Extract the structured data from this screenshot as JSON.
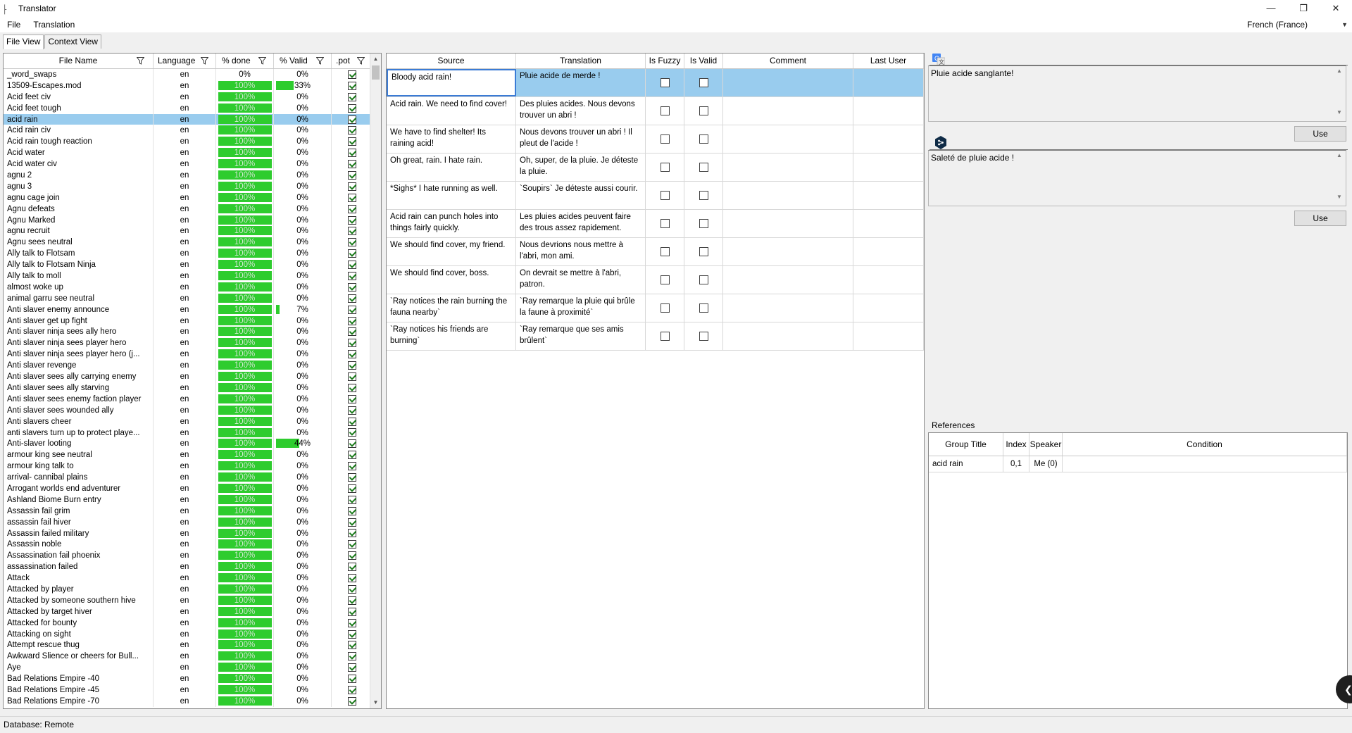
{
  "window": {
    "title": "Translator",
    "min": "—",
    "restore": "❐",
    "close": "✕"
  },
  "menu": {
    "file": "File",
    "translation": "Translation"
  },
  "language_select": {
    "value": "French (France)"
  },
  "tabs": [
    {
      "label": "File View"
    },
    {
      "label": "Context View"
    }
  ],
  "file_table": {
    "headers": {
      "name": "File Name",
      "lang": "Language",
      "done": "% done",
      "valid": "% Valid",
      "pot": ".pot"
    },
    "rows": [
      {
        "name": "_word_swaps",
        "lang": "en",
        "done": "0%",
        "done_pct": 0,
        "valid": "0%",
        "valid_pct": 0,
        "pot": true
      },
      {
        "name": "13509-Escapes.mod",
        "lang": "en",
        "done": "100%",
        "done_pct": 100,
        "valid": "33%",
        "valid_pct": 33,
        "pot": true
      },
      {
        "name": "Acid feet civ",
        "lang": "en",
        "done": "100%",
        "done_pct": 100,
        "valid": "0%",
        "valid_pct": 0,
        "pot": true
      },
      {
        "name": "Acid feet tough",
        "lang": "en",
        "done": "100%",
        "done_pct": 100,
        "valid": "0%",
        "valid_pct": 0,
        "pot": true
      },
      {
        "name": "acid rain",
        "lang": "en",
        "done": "100%",
        "done_pct": 100,
        "valid": "0%",
        "valid_pct": 0,
        "pot": true,
        "selected": true
      },
      {
        "name": "Acid rain civ",
        "lang": "en",
        "done": "100%",
        "done_pct": 100,
        "valid": "0%",
        "valid_pct": 0,
        "pot": true
      },
      {
        "name": "Acid rain tough reaction",
        "lang": "en",
        "done": "100%",
        "done_pct": 100,
        "valid": "0%",
        "valid_pct": 0,
        "pot": true
      },
      {
        "name": "Acid water",
        "lang": "en",
        "done": "100%",
        "done_pct": 100,
        "valid": "0%",
        "valid_pct": 0,
        "pot": true
      },
      {
        "name": "Acid water civ",
        "lang": "en",
        "done": "100%",
        "done_pct": 100,
        "valid": "0%",
        "valid_pct": 0,
        "pot": true
      },
      {
        "name": "agnu 2",
        "lang": "en",
        "done": "100%",
        "done_pct": 100,
        "valid": "0%",
        "valid_pct": 0,
        "pot": true
      },
      {
        "name": "agnu 3",
        "lang": "en",
        "done": "100%",
        "done_pct": 100,
        "valid": "0%",
        "valid_pct": 0,
        "pot": true
      },
      {
        "name": "agnu cage join",
        "lang": "en",
        "done": "100%",
        "done_pct": 100,
        "valid": "0%",
        "valid_pct": 0,
        "pot": true
      },
      {
        "name": "Agnu defeats",
        "lang": "en",
        "done": "100%",
        "done_pct": 100,
        "valid": "0%",
        "valid_pct": 0,
        "pot": true
      },
      {
        "name": "Agnu Marked",
        "lang": "en",
        "done": "100%",
        "done_pct": 100,
        "valid": "0%",
        "valid_pct": 0,
        "pot": true
      },
      {
        "name": "agnu recruit",
        "lang": "en",
        "done": "100%",
        "done_pct": 100,
        "valid": "0%",
        "valid_pct": 0,
        "pot": true
      },
      {
        "name": "Agnu sees neutral",
        "lang": "en",
        "done": "100%",
        "done_pct": 100,
        "valid": "0%",
        "valid_pct": 0,
        "pot": true
      },
      {
        "name": "Ally talk to Flotsam",
        "lang": "en",
        "done": "100%",
        "done_pct": 100,
        "valid": "0%",
        "valid_pct": 0,
        "pot": true
      },
      {
        "name": "Ally talk to Flotsam Ninja",
        "lang": "en",
        "done": "100%",
        "done_pct": 100,
        "valid": "0%",
        "valid_pct": 0,
        "pot": true
      },
      {
        "name": "Ally talk to moll",
        "lang": "en",
        "done": "100%",
        "done_pct": 100,
        "valid": "0%",
        "valid_pct": 0,
        "pot": true
      },
      {
        "name": "almost woke up",
        "lang": "en",
        "done": "100%",
        "done_pct": 100,
        "valid": "0%",
        "valid_pct": 0,
        "pot": true
      },
      {
        "name": "animal garru see neutral",
        "lang": "en",
        "done": "100%",
        "done_pct": 100,
        "valid": "0%",
        "valid_pct": 0,
        "pot": true
      },
      {
        "name": "Anti slaver enemy announce",
        "lang": "en",
        "done": "100%",
        "done_pct": 100,
        "valid": "7%",
        "valid_pct": 7,
        "pot": true
      },
      {
        "name": "Anti slaver get up fight",
        "lang": "en",
        "done": "100%",
        "done_pct": 100,
        "valid": "0%",
        "valid_pct": 0,
        "pot": true
      },
      {
        "name": "Anti slaver ninja sees ally hero",
        "lang": "en",
        "done": "100%",
        "done_pct": 100,
        "valid": "0%",
        "valid_pct": 0,
        "pot": true
      },
      {
        "name": "Anti slaver ninja sees player hero",
        "lang": "en",
        "done": "100%",
        "done_pct": 100,
        "valid": "0%",
        "valid_pct": 0,
        "pot": true
      },
      {
        "name": "Anti slaver ninja sees player hero (j...",
        "lang": "en",
        "done": "100%",
        "done_pct": 100,
        "valid": "0%",
        "valid_pct": 0,
        "pot": true
      },
      {
        "name": "Anti slaver revenge",
        "lang": "en",
        "done": "100%",
        "done_pct": 100,
        "valid": "0%",
        "valid_pct": 0,
        "pot": true
      },
      {
        "name": "Anti slaver sees ally carrying enemy",
        "lang": "en",
        "done": "100%",
        "done_pct": 100,
        "valid": "0%",
        "valid_pct": 0,
        "pot": true
      },
      {
        "name": "Anti slaver sees ally starving",
        "lang": "en",
        "done": "100%",
        "done_pct": 100,
        "valid": "0%",
        "valid_pct": 0,
        "pot": true
      },
      {
        "name": "Anti slaver sees enemy faction player",
        "lang": "en",
        "done": "100%",
        "done_pct": 100,
        "valid": "0%",
        "valid_pct": 0,
        "pot": true
      },
      {
        "name": "Anti slaver sees wounded ally",
        "lang": "en",
        "done": "100%",
        "done_pct": 100,
        "valid": "0%",
        "valid_pct": 0,
        "pot": true
      },
      {
        "name": "Anti slavers cheer",
        "lang": "en",
        "done": "100%",
        "done_pct": 100,
        "valid": "0%",
        "valid_pct": 0,
        "pot": true
      },
      {
        "name": "anti slavers turn up to protect playe...",
        "lang": "en",
        "done": "100%",
        "done_pct": 100,
        "valid": "0%",
        "valid_pct": 0,
        "pot": true
      },
      {
        "name": "Anti-slaver looting",
        "lang": "en",
        "done": "100%",
        "done_pct": 100,
        "valid": "44%",
        "valid_pct": 44,
        "pot": true
      },
      {
        "name": "armour king see neutral",
        "lang": "en",
        "done": "100%",
        "done_pct": 100,
        "valid": "0%",
        "valid_pct": 0,
        "pot": true
      },
      {
        "name": "armour king talk to",
        "lang": "en",
        "done": "100%",
        "done_pct": 100,
        "valid": "0%",
        "valid_pct": 0,
        "pot": true
      },
      {
        "name": "arrival- cannibal plains",
        "lang": "en",
        "done": "100%",
        "done_pct": 100,
        "valid": "0%",
        "valid_pct": 0,
        "pot": true
      },
      {
        "name": "Arrogant worlds end adventurer",
        "lang": "en",
        "done": "100%",
        "done_pct": 100,
        "valid": "0%",
        "valid_pct": 0,
        "pot": true
      },
      {
        "name": "Ashland Biome Burn entry",
        "lang": "en",
        "done": "100%",
        "done_pct": 100,
        "valid": "0%",
        "valid_pct": 0,
        "pot": true
      },
      {
        "name": "Assassin fail grim",
        "lang": "en",
        "done": "100%",
        "done_pct": 100,
        "valid": "0%",
        "valid_pct": 0,
        "pot": true
      },
      {
        "name": "assassin fail hiver",
        "lang": "en",
        "done": "100%",
        "done_pct": 100,
        "valid": "0%",
        "valid_pct": 0,
        "pot": true
      },
      {
        "name": "Assassin failed military",
        "lang": "en",
        "done": "100%",
        "done_pct": 100,
        "valid": "0%",
        "valid_pct": 0,
        "pot": true
      },
      {
        "name": "Assassin noble",
        "lang": "en",
        "done": "100%",
        "done_pct": 100,
        "valid": "0%",
        "valid_pct": 0,
        "pot": true
      },
      {
        "name": "Assassination fail phoenix",
        "lang": "en",
        "done": "100%",
        "done_pct": 100,
        "valid": "0%",
        "valid_pct": 0,
        "pot": true
      },
      {
        "name": "assassination failed",
        "lang": "en",
        "done": "100%",
        "done_pct": 100,
        "valid": "0%",
        "valid_pct": 0,
        "pot": true
      },
      {
        "name": "Attack",
        "lang": "en",
        "done": "100%",
        "done_pct": 100,
        "valid": "0%",
        "valid_pct": 0,
        "pot": true
      },
      {
        "name": "Attacked by player",
        "lang": "en",
        "done": "100%",
        "done_pct": 100,
        "valid": "0%",
        "valid_pct": 0,
        "pot": true
      },
      {
        "name": "Attacked by someone southern hive",
        "lang": "en",
        "done": "100%",
        "done_pct": 100,
        "valid": "0%",
        "valid_pct": 0,
        "pot": true
      },
      {
        "name": "Attacked by target hiver",
        "lang": "en",
        "done": "100%",
        "done_pct": 100,
        "valid": "0%",
        "valid_pct": 0,
        "pot": true
      },
      {
        "name": "Attacked for bounty",
        "lang": "en",
        "done": "100%",
        "done_pct": 100,
        "valid": "0%",
        "valid_pct": 0,
        "pot": true
      },
      {
        "name": "Attacking on sight",
        "lang": "en",
        "done": "100%",
        "done_pct": 100,
        "valid": "0%",
        "valid_pct": 0,
        "pot": true
      },
      {
        "name": "Attempt rescue thug",
        "lang": "en",
        "done": "100%",
        "done_pct": 100,
        "valid": "0%",
        "valid_pct": 0,
        "pot": true
      },
      {
        "name": "Awkward Slience or cheers for Bull...",
        "lang": "en",
        "done": "100%",
        "done_pct": 100,
        "valid": "0%",
        "valid_pct": 0,
        "pot": true
      },
      {
        "name": "Aye",
        "lang": "en",
        "done": "100%",
        "done_pct": 100,
        "valid": "0%",
        "valid_pct": 0,
        "pot": true
      },
      {
        "name": "Bad Relations Empire -40",
        "lang": "en",
        "done": "100%",
        "done_pct": 100,
        "valid": "0%",
        "valid_pct": 0,
        "pot": true
      },
      {
        "name": "Bad Relations Empire -45",
        "lang": "en",
        "done": "100%",
        "done_pct": 100,
        "valid": "0%",
        "valid_pct": 0,
        "pot": true
      },
      {
        "name": "Bad Relations Empire -70",
        "lang": "en",
        "done": "100%",
        "done_pct": 100,
        "valid": "0%",
        "valid_pct": 0,
        "pot": true
      }
    ]
  },
  "trans_table": {
    "headers": {
      "source": "Source",
      "translation": "Translation",
      "fuzzy": "Is Fuzzy",
      "valid": "Is Valid",
      "comment": "Comment",
      "last_user": "Last User"
    },
    "rows": [
      {
        "source": "Bloody acid rain!",
        "translation": "Pluie acide de merde !",
        "fuzzy": false,
        "valid": false,
        "selected": true
      },
      {
        "source": "Acid rain. We need to find cover!",
        "translation": "Des pluies acides. Nous devons trouver un abri !",
        "fuzzy": false,
        "valid": false
      },
      {
        "source": "We have to find shelter! Its raining acid!",
        "translation": "Nous devons trouver un abri ! Il pleut de l'acide !",
        "fuzzy": false,
        "valid": false
      },
      {
        "source": "Oh great, rain. I hate rain.",
        "translation": "Oh, super, de la pluie. Je déteste la pluie.",
        "fuzzy": false,
        "valid": false
      },
      {
        "source": "*Sighs* I hate running as well.",
        "translation": "`Soupirs` Je déteste aussi courir.",
        "fuzzy": false,
        "valid": false
      },
      {
        "source": "Acid rain can punch holes into things fairly quickly.",
        "translation": "Les pluies acides peuvent faire des trous assez rapidement.",
        "fuzzy": false,
        "valid": false
      },
      {
        "source": "We should find cover, my friend.",
        "translation": "Nous devrions nous mettre à l'abri, mon ami.",
        "fuzzy": false,
        "valid": false
      },
      {
        "source": "We should find cover, boss.",
        "translation": "On devrait se mettre à l'abri, patron.",
        "fuzzy": false,
        "valid": false
      },
      {
        "source": "`Ray notices the rain burning the fauna nearby`",
        "translation": "`Ray remarque la pluie qui brûle la faune à proximité`",
        "fuzzy": false,
        "valid": false
      },
      {
        "source": "`Ray notices his friends are burning`",
        "translation": "`Ray remarque que ses amis brûlent`",
        "fuzzy": false,
        "valid": false
      }
    ]
  },
  "suggestions": [
    {
      "icon": "google-translate-icon",
      "text": "Pluie acide sanglante!",
      "button": "Use"
    },
    {
      "icon": "deepl-icon",
      "text": "Saleté de pluie acide !",
      "button": "Use"
    }
  ],
  "references": {
    "label": "References",
    "headers": {
      "group": "Group Title",
      "index": "Index",
      "speaker": "Speaker",
      "condition": "Condition"
    },
    "rows": [
      {
        "group": "acid rain",
        "index": "0,1",
        "speaker": "Me (0)",
        "condition": ""
      }
    ]
  },
  "status": {
    "text": "Database: Remote"
  },
  "colors": {
    "accent_selection": "#99ccee",
    "progress_green": "#2ecc2e"
  }
}
